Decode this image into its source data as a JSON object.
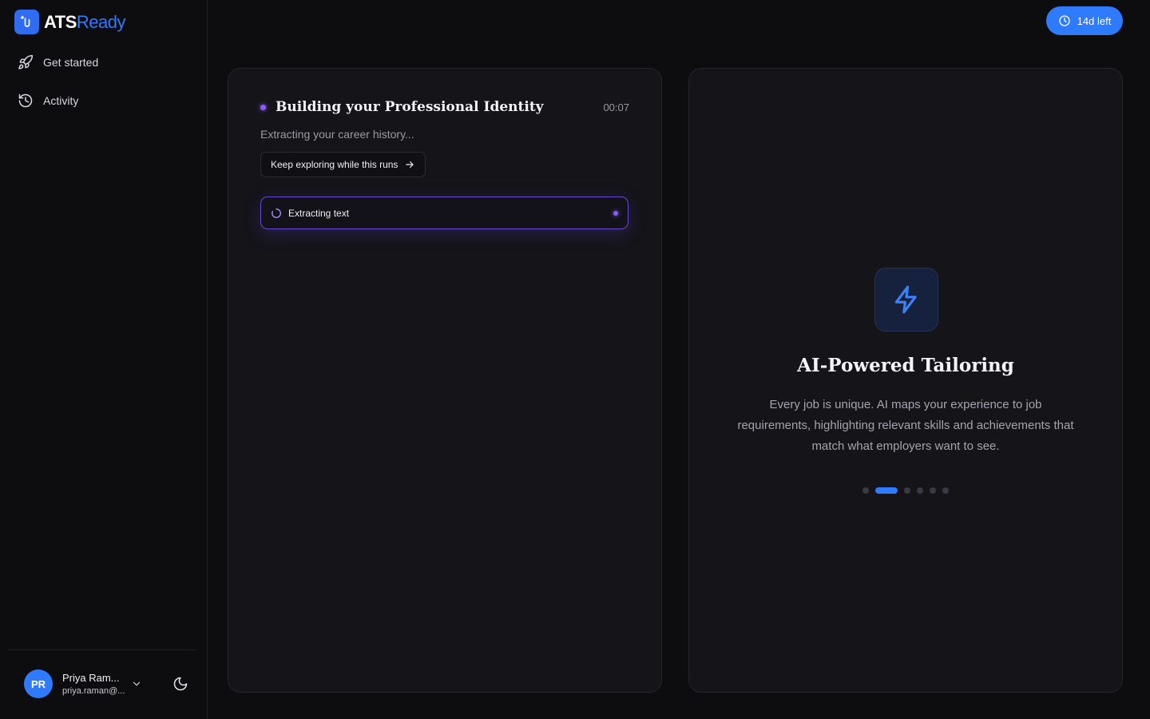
{
  "brand": {
    "part1": "ATS",
    "part2": "Ready"
  },
  "nav": [
    {
      "label": "Get started",
      "icon": "rocket-icon"
    },
    {
      "label": "Activity",
      "icon": "history-icon"
    }
  ],
  "user": {
    "initials": "PR",
    "name": "Priya Ram...",
    "email": "priya.raman@..."
  },
  "trial": {
    "label": "14d left"
  },
  "task": {
    "title": "Building your Professional Identity",
    "timer": "00:07",
    "subtitle": "Extracting your career history...",
    "explore_label": "Keep exploring while this runs",
    "step_label": "Extracting text"
  },
  "feature": {
    "title": "AI-Powered Tailoring",
    "description": "Every job is unique. AI maps your experience to job requirements, highlighting relevant skills and achievements that match what employers want to see.",
    "slide_count": 6,
    "active_slide": 2
  },
  "colors": {
    "accent": "#2f7bff",
    "progress": "#8a5cf6",
    "background": "#0d0d10",
    "card": "#141419"
  }
}
